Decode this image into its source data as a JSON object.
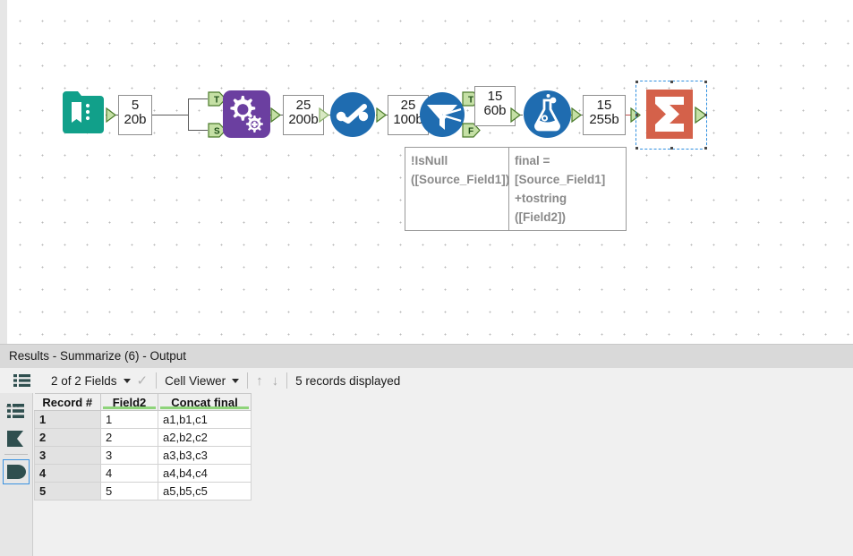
{
  "canvas": {
    "tools": [
      {
        "id": "input-data",
        "name": "Input Data",
        "color": "#11a08a"
      },
      {
        "id": "find-replace",
        "name": "Find Replace",
        "color": "#6b3fa0"
      },
      {
        "id": "select",
        "name": "Select",
        "color": "#1f6cb0"
      },
      {
        "id": "filter",
        "name": "Filter",
        "color": "#1f6cb0"
      },
      {
        "id": "formula",
        "name": "Formula",
        "color": "#1f6cb0"
      },
      {
        "id": "summarize",
        "name": "Summarize",
        "color": "#d4614a"
      }
    ],
    "data_boxes": [
      {
        "id": "box-input",
        "records": "5",
        "size": "20b"
      },
      {
        "id": "box-findreplace",
        "records": "25",
        "size": "200b"
      },
      {
        "id": "box-select",
        "records": "25",
        "size": "100b"
      },
      {
        "id": "box-filter-true",
        "records": "15",
        "size": "60b"
      },
      {
        "id": "box-formula",
        "records": "15",
        "size": "255b"
      }
    ],
    "ports": [
      {
        "id": "port-target",
        "label": "T"
      },
      {
        "id": "port-source",
        "label": "S"
      },
      {
        "id": "port-true",
        "label": "T"
      },
      {
        "id": "port-false",
        "label": "F"
      }
    ],
    "annotations": [
      {
        "id": "filter-annotation",
        "text": "!IsNull\n([Source_Field1])"
      },
      {
        "id": "formula-annotation",
        "text": "final =\n[Source_Field1]\n+tostring\n([Field2])"
      }
    ],
    "selection": {
      "selected_tool": "summarize",
      "color": "#2f8fe0"
    }
  },
  "results": {
    "title": "Results - Summarize (6) - Output",
    "toolbar": {
      "fields_selector": "2 of 2 Fields",
      "view_mode": "Cell Viewer",
      "sort_up": "↑",
      "sort_down": "↓",
      "record_status": "5 records displayed"
    },
    "rail": {
      "items": [
        {
          "id": "rail-messages-icon",
          "name": "list-icon"
        },
        {
          "id": "rail-flag-icon",
          "name": "flag-icon"
        },
        {
          "id": "rail-tag-icon",
          "name": "tag-icon",
          "selected": true
        }
      ]
    },
    "grid": {
      "columns": [
        "Record #",
        "Field2",
        "Concat final"
      ],
      "rows": [
        {
          "record": "1",
          "field2": "1",
          "concat_final": "a1,b1,c1"
        },
        {
          "record": "2",
          "field2": "2",
          "concat_final": "a2,b2,c2"
        },
        {
          "record": "3",
          "field2": "3",
          "concat_final": "a3,b3,c3"
        },
        {
          "record": "4",
          "field2": "4",
          "concat_final": "a4,b4,c4"
        },
        {
          "record": "5",
          "field2": "5",
          "concat_final": "a5,b5,c5"
        }
      ]
    }
  }
}
